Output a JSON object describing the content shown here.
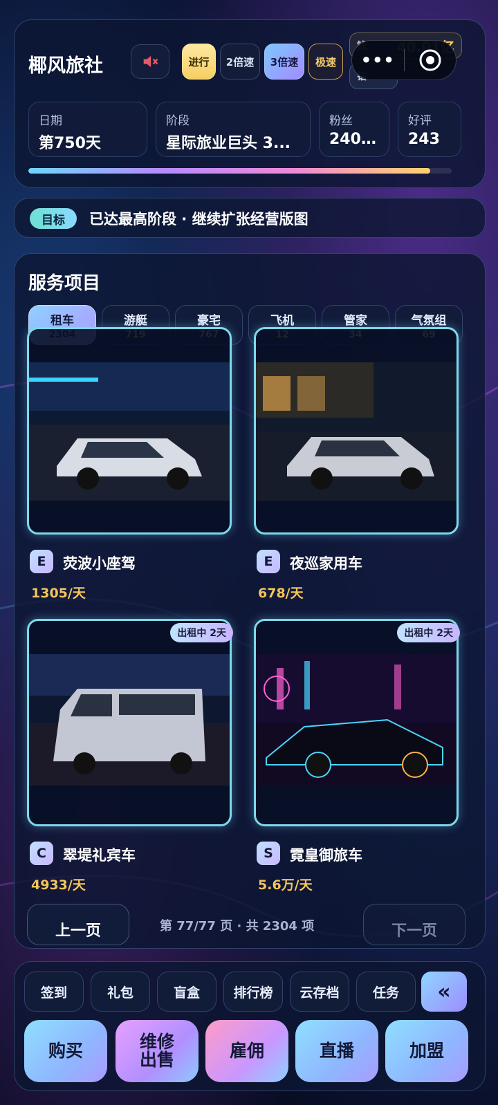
{
  "header": {
    "shop_name": "椰风旅社",
    "mute_icon": "speaker-muted-icon",
    "speed_buttons": {
      "run": "进行",
      "x2": "2倍速",
      "x3": "3倍速",
      "max": "极速"
    },
    "money": {
      "label": "钱",
      "value": "40.01亿"
    },
    "diamond": {
      "label": "钻"
    },
    "capsule": {
      "more": "•••"
    },
    "stats": [
      {
        "label": "日期",
        "value": "第750天"
      },
      {
        "label": "阶段",
        "value": "星际旅业巨头 3..."
      },
      {
        "label": "粉丝",
        "value": "240...."
      },
      {
        "label": "好评",
        "value": "243"
      }
    ],
    "progress": 0.95
  },
  "goal": {
    "tag": "目标",
    "text": "已达最高阶段 · 继续扩张经营版图"
  },
  "services": {
    "title": "服务项目",
    "tabs": [
      {
        "name": "租车",
        "count": "2304"
      },
      {
        "name": "游艇",
        "count": "719"
      },
      {
        "name": "豪宅",
        "count": "767"
      },
      {
        "name": "飞机",
        "count": "12"
      },
      {
        "name": "管家",
        "count": "34"
      },
      {
        "name": "气氛组",
        "count": "69"
      }
    ],
    "cards": [
      {
        "grade": "E",
        "name": "荧波小座驾",
        "price": "1305/天",
        "status": ""
      },
      {
        "grade": "E",
        "name": "夜巡家用车",
        "price": "678/天",
        "status": ""
      },
      {
        "grade": "C",
        "name": "翠堤礼宾车",
        "price": "4933/天",
        "status": "出租中 2天"
      },
      {
        "grade": "S",
        "name": "霓皇御旅车",
        "price": "5.6万/天",
        "status": "出租中 2天"
      }
    ],
    "pager": {
      "prev": "上一页",
      "info": "第 77/77 页 · 共 2304 项",
      "next": "下一页"
    }
  },
  "bottom": {
    "chips": [
      "签到",
      "礼包",
      "盲盒",
      "排行榜",
      "云存档",
      "任务"
    ],
    "collapse": "«",
    "actions": [
      {
        "label": "购买"
      },
      {
        "label": "维修\n出售"
      },
      {
        "label": "雇佣"
      },
      {
        "label": "直播"
      },
      {
        "label": "加盟"
      }
    ]
  }
}
